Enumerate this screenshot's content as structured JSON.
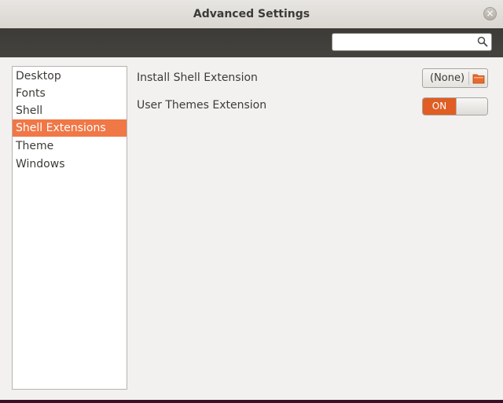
{
  "window": {
    "title": "Advanced Settings",
    "close_symbol": "×"
  },
  "search": {
    "value": "",
    "placeholder": "",
    "icon": "search-icon"
  },
  "sidebar": {
    "items": [
      {
        "label": "Desktop",
        "selected": false
      },
      {
        "label": "Fonts",
        "selected": false
      },
      {
        "label": "Shell",
        "selected": false
      },
      {
        "label": "Shell Extensions",
        "selected": true
      },
      {
        "label": "Theme",
        "selected": false
      },
      {
        "label": "Windows",
        "selected": false
      }
    ]
  },
  "main": {
    "install_label": "Install Shell Extension",
    "install_button_label": "(None)",
    "user_themes_label": "User Themes Extension",
    "user_themes_toggle": "ON"
  },
  "colors": {
    "accent": "#f07746",
    "toggle_on": "#e05d23",
    "toolbar": "#3c3b37"
  }
}
